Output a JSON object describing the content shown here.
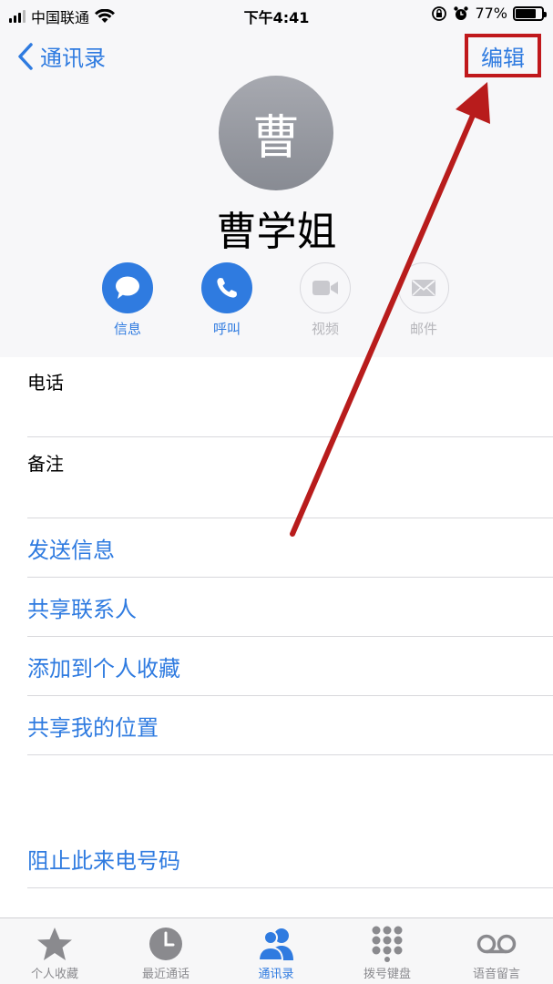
{
  "status_bar": {
    "carrier": "中国联通",
    "time": "下午4:41",
    "battery_percent": "77%",
    "battery_level": 0.77
  },
  "nav": {
    "back_label": "通讯录",
    "edit_label": "编辑"
  },
  "contact": {
    "avatar_initial": "曹",
    "name": "曹学姐"
  },
  "actions": [
    {
      "label": "信息",
      "icon": "message-icon",
      "enabled": true
    },
    {
      "label": "呼叫",
      "icon": "phone-icon",
      "enabled": true
    },
    {
      "label": "视频",
      "icon": "video-icon",
      "enabled": false
    },
    {
      "label": "邮件",
      "icon": "mail-icon",
      "enabled": false
    }
  ],
  "fields": {
    "phone_label": "电话",
    "notes_label": "备注"
  },
  "links": {
    "send_message": "发送信息",
    "share_contact": "共享联系人",
    "add_favorite": "添加到个人收藏",
    "share_location": "共享我的位置",
    "block_caller": "阻止此来电号码"
  },
  "tab_bar": {
    "tabs": [
      {
        "label": "个人收藏",
        "icon": "star-icon",
        "active": false
      },
      {
        "label": "最近通话",
        "icon": "clock-icon",
        "active": false
      },
      {
        "label": "通讯录",
        "icon": "contacts-icon",
        "active": true
      },
      {
        "label": "拨号键盘",
        "icon": "keypad-icon",
        "active": false
      },
      {
        "label": "语音留言",
        "icon": "voicemail-icon",
        "active": false
      }
    ]
  },
  "colors": {
    "accent": "#2f7be0",
    "highlight_box": "#c0181c",
    "arrow": "#b81c1c"
  }
}
